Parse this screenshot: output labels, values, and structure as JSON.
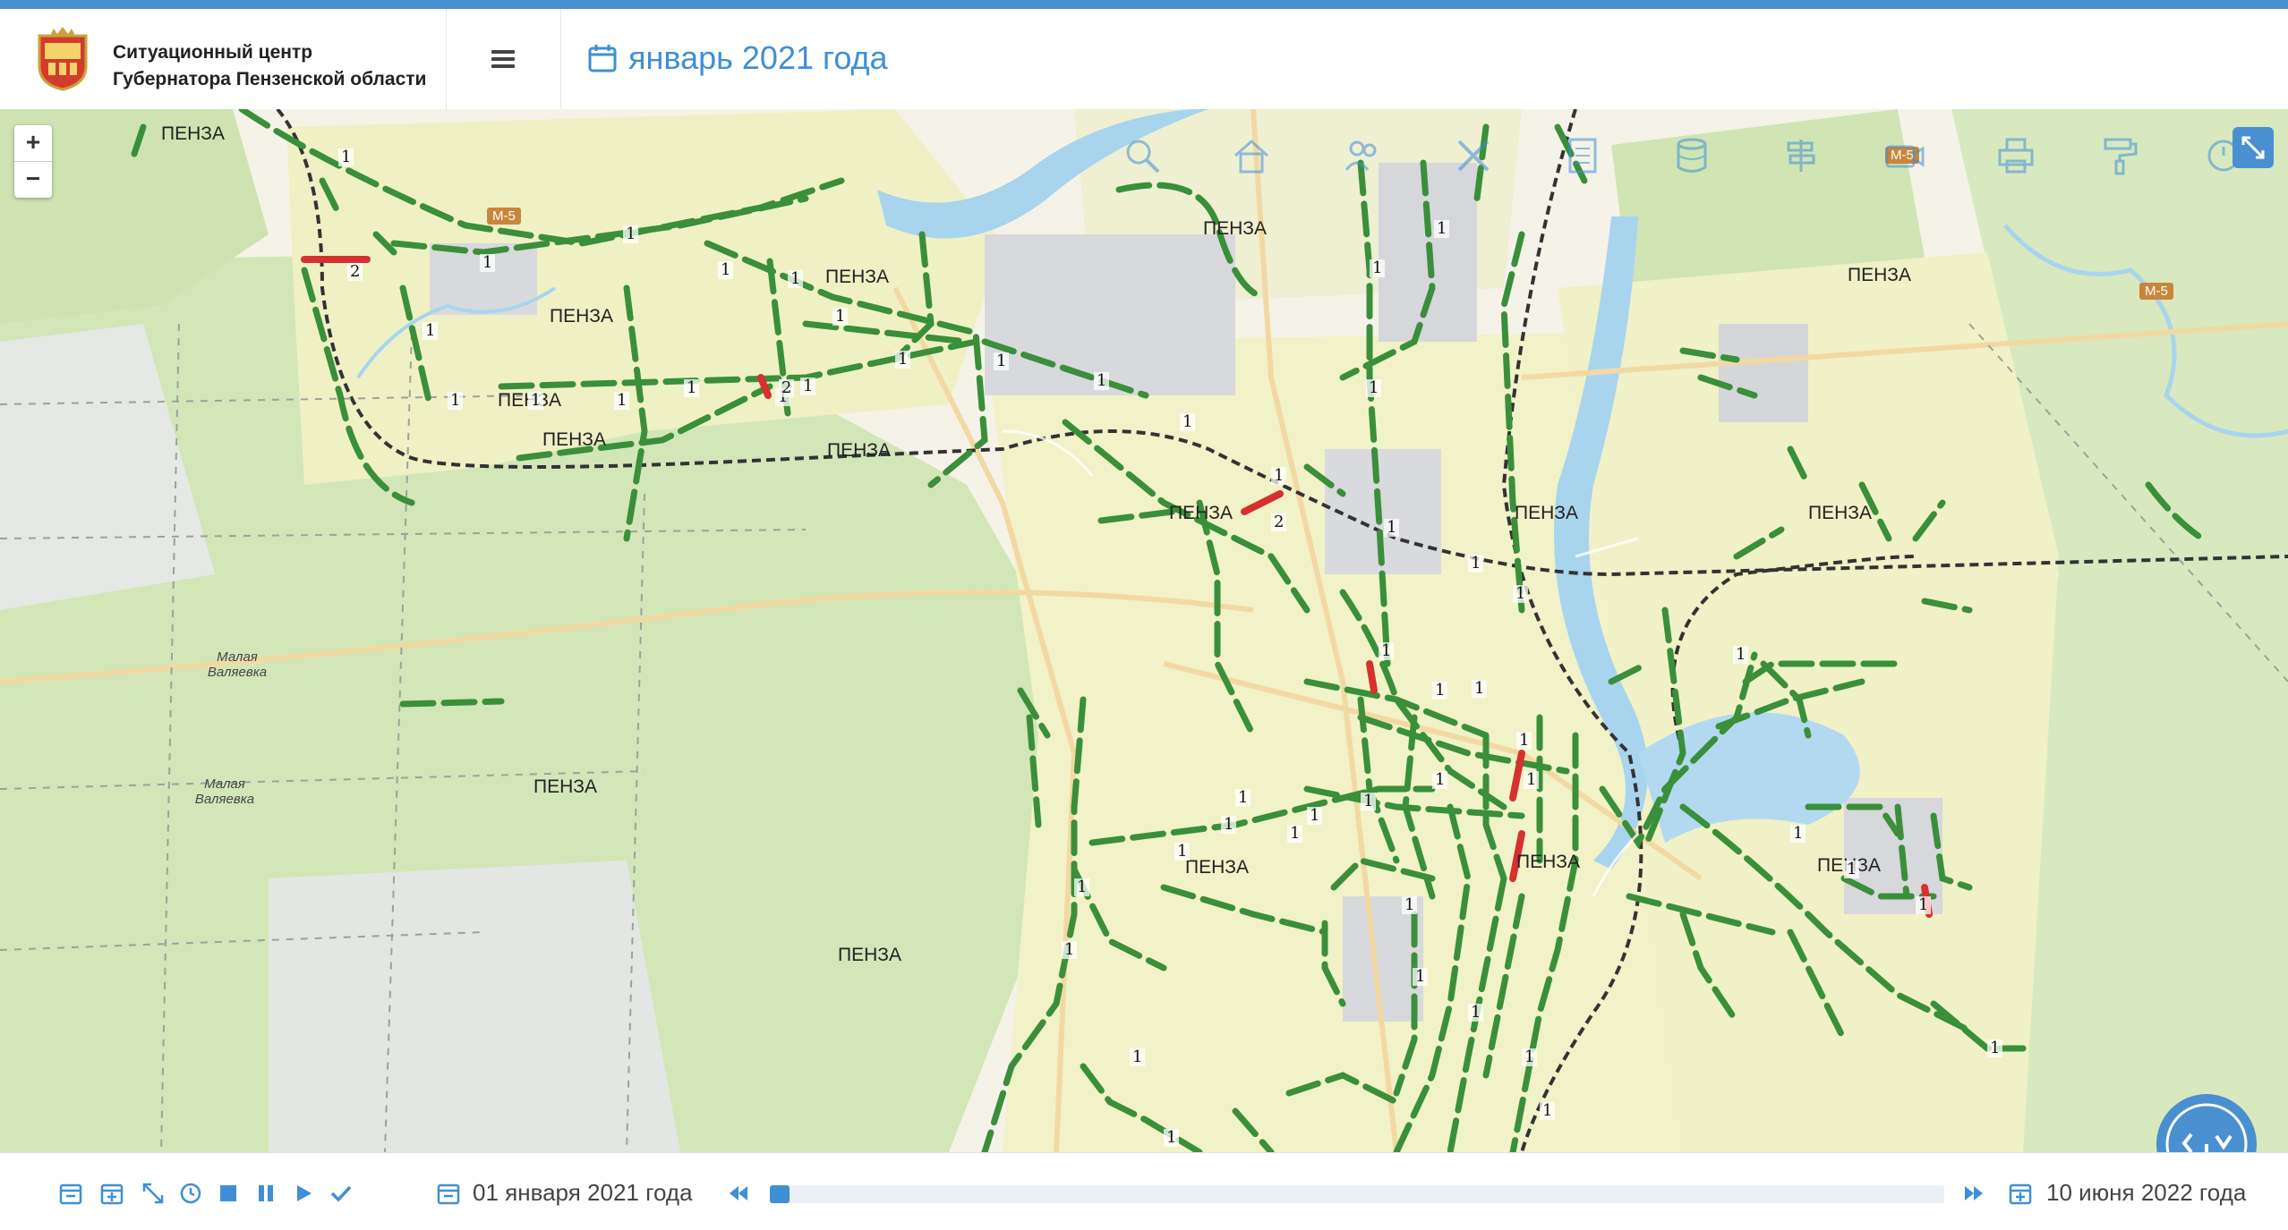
{
  "header": {
    "title_line1": "Ситуационный центр",
    "title_line2": "Губернатора Пензенской области",
    "period_label": "январь 2021 года",
    "menu_icon": "hamburger-icon"
  },
  "colors": {
    "accent": "#3f8fd6",
    "road_ok": "#3a8f3a",
    "road_alert": "#d63030",
    "water": "#a8d4ee",
    "forest": "#c9dfae",
    "urban": "#eef0c4"
  },
  "map": {
    "zoom_in_label": "+",
    "zoom_out_label": "−",
    "toolbar_icons": [
      "search-icon",
      "home-icon",
      "people-icon",
      "tools-icon",
      "document-icon",
      "database-icon",
      "signpost-icon",
      "camera-icon",
      "printer-icon",
      "paint-roller-icon",
      "time-icon"
    ],
    "place_labels": [
      "ПЕНЗА",
      "ПЕНЗА",
      "ПЕНЗА",
      "ПЕНЗА",
      "ПЕНЗА",
      "ПЕНЗА",
      "ПЕНЗА",
      "ПЕНЗА",
      "ПЕНЗА",
      "ПЕНЗА",
      "ПЕНЗА",
      "ПЕНЗА",
      "ПЕНЗА",
      "ПЕНЗА",
      "ПЕНЗА",
      "ПЕНЗА"
    ],
    "village_1": "Малая Валяевка",
    "village_2": "Малая Валяевка",
    "highway_labels": [
      "М-5",
      "М-5",
      "М-5"
    ],
    "road_markers": [
      "1",
      "1",
      "1",
      "1",
      "1",
      "1",
      "1",
      "1",
      "1",
      "1",
      "1",
      "1",
      "1",
      "1",
      "1",
      "1",
      "1",
      "1",
      "1",
      "1",
      "1",
      "1",
      "1",
      "1",
      "1",
      "1",
      "1",
      "1",
      "1",
      "1",
      "1",
      "1",
      "1",
      "1",
      "1",
      "1",
      "1",
      "1",
      "1",
      "1",
      "1",
      "1",
      "1",
      "1",
      "1",
      "1",
      "1",
      "1",
      "1",
      "1",
      "2",
      "2",
      "2"
    ]
  },
  "timeline": {
    "start_date": "01 января 2021 года",
    "end_date": "10 июня 2022 года",
    "progress_fraction": 0.01,
    "controls": [
      "calendar-icon",
      "calendar-plus-icon",
      "expand-icon",
      "clock-icon",
      "stop-icon",
      "pause-icon",
      "play-icon",
      "check-icon"
    ]
  }
}
